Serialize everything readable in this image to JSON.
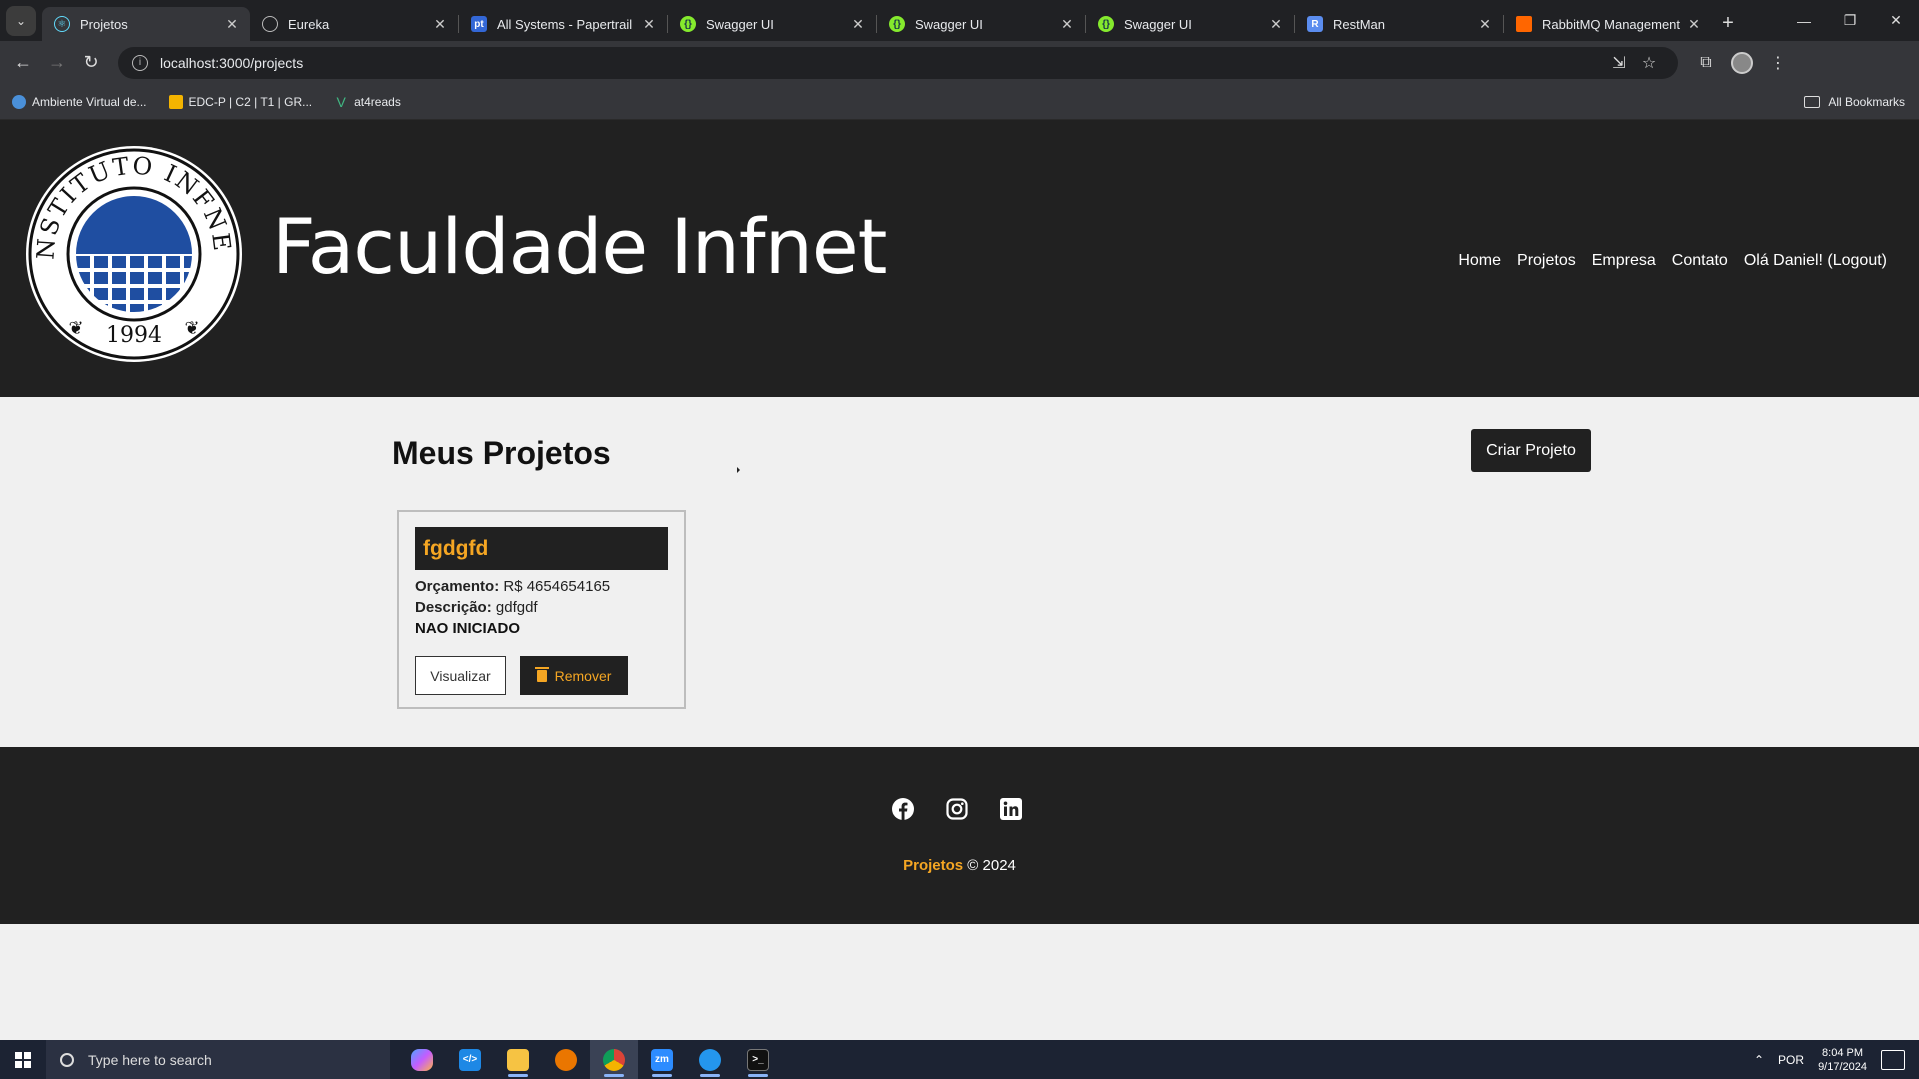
{
  "browser": {
    "tabs": [
      {
        "title": "Projetos",
        "icon": "react-icon",
        "color": "#61dafb",
        "active": true
      },
      {
        "title": "Eureka",
        "icon": "globe-icon",
        "color": "#9aa0a6"
      },
      {
        "title": "All Systems - Papertrail",
        "icon": "papertrail-icon",
        "color": "#3367d6"
      },
      {
        "title": "Swagger UI",
        "icon": "swagger-icon",
        "color": "#85ea2d"
      },
      {
        "title": "Swagger UI",
        "icon": "swagger-icon",
        "color": "#85ea2d"
      },
      {
        "title": "Swagger UI",
        "icon": "swagger-icon",
        "color": "#85ea2d"
      },
      {
        "title": "RestMan",
        "icon": "restman-icon",
        "color": "#5b8def"
      },
      {
        "title": "RabbitMQ Management",
        "icon": "rabbitmq-icon",
        "color": "#ff6600"
      }
    ],
    "url": "localhost:3000/projects",
    "bookmarks": [
      {
        "label": "Ambiente Virtual de...",
        "icon": "globe-icon",
        "color": "#4a90d9"
      },
      {
        "label": "EDC-P | C2 | T1 | GR...",
        "icon": "drive-icon",
        "color": "#f4b400"
      },
      {
        "label": "at4reads",
        "icon": "vue-icon",
        "color": "#41b883"
      }
    ],
    "all_bookmarks": "All Bookmarks"
  },
  "header": {
    "brand": "Faculdade Infnet",
    "logo": {
      "ring_text": "INSTITUTO INFNET",
      "year": "1994"
    },
    "nav": [
      "Home",
      "Projetos",
      "Empresa",
      "Contato",
      "Olá Daniel! (Logout)"
    ]
  },
  "main": {
    "title": "Meus Projetos",
    "create_label": "Criar Projeto",
    "project": {
      "name": "fgdgfd",
      "budget_label": "Orçamento:",
      "budget_value": "R$ 4654654165",
      "desc_label": "Descrição:",
      "desc_value": "gdfgdf",
      "status": "NAO INICIADO",
      "view_label": "Visualizar",
      "remove_label": "Remover"
    }
  },
  "footer": {
    "socials": [
      "facebook-icon",
      "instagram-icon",
      "linkedin-icon"
    ],
    "brand": "Projetos",
    "copyright": "© 2024"
  },
  "colors": {
    "accent": "#f5a623",
    "dark": "#212121",
    "light": "#f0f0f0"
  },
  "taskbar": {
    "search_placeholder": "Type here to search",
    "apps": [
      "copilot-icon",
      "vscode-icon",
      "file-explorer-icon",
      "blender-icon",
      "chrome-icon",
      "zoom-icon",
      "docker-icon",
      "terminal-icon"
    ],
    "language": "POR",
    "time": "8:04 PM",
    "date": "9/17/2024"
  }
}
